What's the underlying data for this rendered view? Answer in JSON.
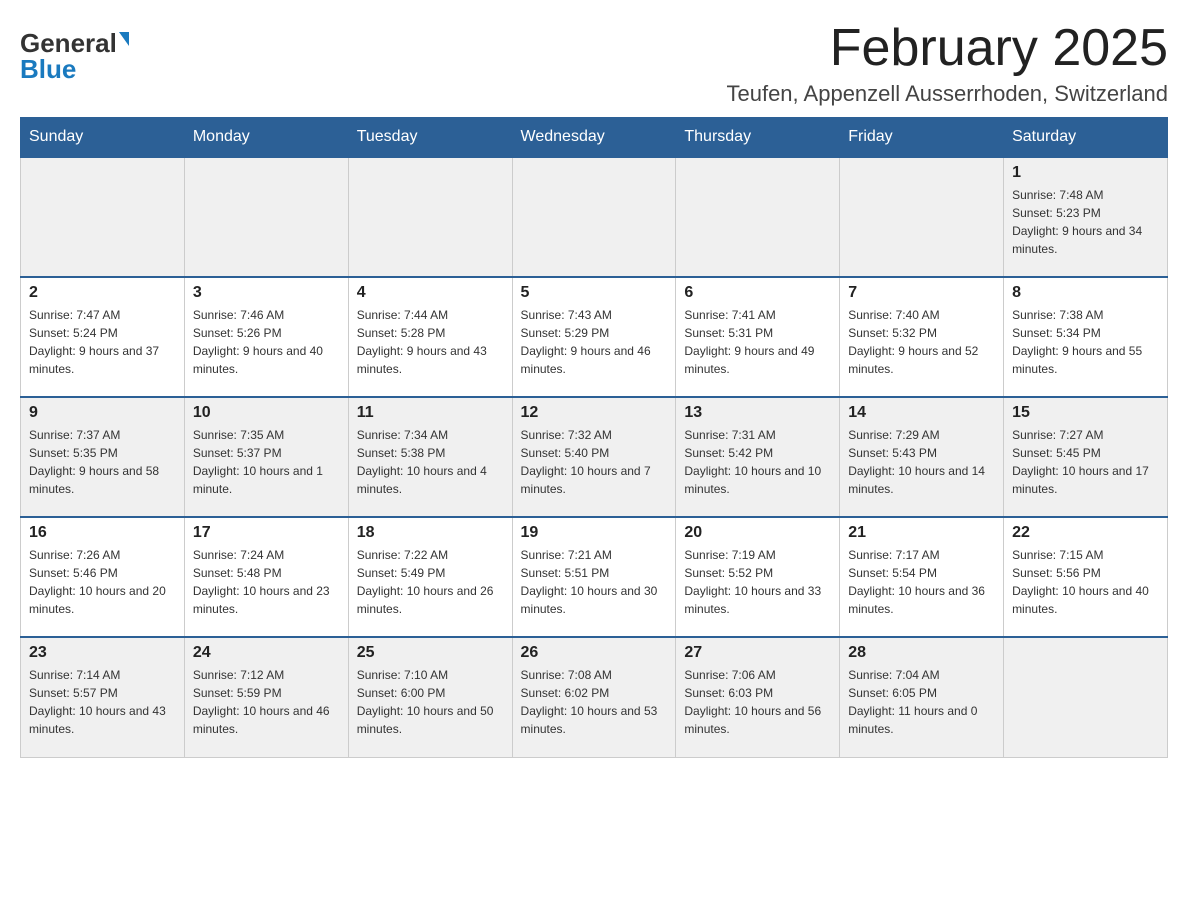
{
  "header": {
    "logo_general": "General",
    "logo_blue": "Blue",
    "month_title": "February 2025",
    "location": "Teufen, Appenzell Ausserrhoden, Switzerland"
  },
  "calendar": {
    "days_of_week": [
      "Sunday",
      "Monday",
      "Tuesday",
      "Wednesday",
      "Thursday",
      "Friday",
      "Saturday"
    ],
    "weeks": [
      {
        "row_class": "row-odd",
        "days": [
          {
            "num": "",
            "info": ""
          },
          {
            "num": "",
            "info": ""
          },
          {
            "num": "",
            "info": ""
          },
          {
            "num": "",
            "info": ""
          },
          {
            "num": "",
            "info": ""
          },
          {
            "num": "",
            "info": ""
          },
          {
            "num": "1",
            "info": "Sunrise: 7:48 AM\nSunset: 5:23 PM\nDaylight: 9 hours and 34 minutes."
          }
        ]
      },
      {
        "row_class": "row-even",
        "days": [
          {
            "num": "2",
            "info": "Sunrise: 7:47 AM\nSunset: 5:24 PM\nDaylight: 9 hours and 37 minutes."
          },
          {
            "num": "3",
            "info": "Sunrise: 7:46 AM\nSunset: 5:26 PM\nDaylight: 9 hours and 40 minutes."
          },
          {
            "num": "4",
            "info": "Sunrise: 7:44 AM\nSunset: 5:28 PM\nDaylight: 9 hours and 43 minutes."
          },
          {
            "num": "5",
            "info": "Sunrise: 7:43 AM\nSunset: 5:29 PM\nDaylight: 9 hours and 46 minutes."
          },
          {
            "num": "6",
            "info": "Sunrise: 7:41 AM\nSunset: 5:31 PM\nDaylight: 9 hours and 49 minutes."
          },
          {
            "num": "7",
            "info": "Sunrise: 7:40 AM\nSunset: 5:32 PM\nDaylight: 9 hours and 52 minutes."
          },
          {
            "num": "8",
            "info": "Sunrise: 7:38 AM\nSunset: 5:34 PM\nDaylight: 9 hours and 55 minutes."
          }
        ]
      },
      {
        "row_class": "row-odd",
        "days": [
          {
            "num": "9",
            "info": "Sunrise: 7:37 AM\nSunset: 5:35 PM\nDaylight: 9 hours and 58 minutes."
          },
          {
            "num": "10",
            "info": "Sunrise: 7:35 AM\nSunset: 5:37 PM\nDaylight: 10 hours and 1 minute."
          },
          {
            "num": "11",
            "info": "Sunrise: 7:34 AM\nSunset: 5:38 PM\nDaylight: 10 hours and 4 minutes."
          },
          {
            "num": "12",
            "info": "Sunrise: 7:32 AM\nSunset: 5:40 PM\nDaylight: 10 hours and 7 minutes."
          },
          {
            "num": "13",
            "info": "Sunrise: 7:31 AM\nSunset: 5:42 PM\nDaylight: 10 hours and 10 minutes."
          },
          {
            "num": "14",
            "info": "Sunrise: 7:29 AM\nSunset: 5:43 PM\nDaylight: 10 hours and 14 minutes."
          },
          {
            "num": "15",
            "info": "Sunrise: 7:27 AM\nSunset: 5:45 PM\nDaylight: 10 hours and 17 minutes."
          }
        ]
      },
      {
        "row_class": "row-even",
        "days": [
          {
            "num": "16",
            "info": "Sunrise: 7:26 AM\nSunset: 5:46 PM\nDaylight: 10 hours and 20 minutes."
          },
          {
            "num": "17",
            "info": "Sunrise: 7:24 AM\nSunset: 5:48 PM\nDaylight: 10 hours and 23 minutes."
          },
          {
            "num": "18",
            "info": "Sunrise: 7:22 AM\nSunset: 5:49 PM\nDaylight: 10 hours and 26 minutes."
          },
          {
            "num": "19",
            "info": "Sunrise: 7:21 AM\nSunset: 5:51 PM\nDaylight: 10 hours and 30 minutes."
          },
          {
            "num": "20",
            "info": "Sunrise: 7:19 AM\nSunset: 5:52 PM\nDaylight: 10 hours and 33 minutes."
          },
          {
            "num": "21",
            "info": "Sunrise: 7:17 AM\nSunset: 5:54 PM\nDaylight: 10 hours and 36 minutes."
          },
          {
            "num": "22",
            "info": "Sunrise: 7:15 AM\nSunset: 5:56 PM\nDaylight: 10 hours and 40 minutes."
          }
        ]
      },
      {
        "row_class": "row-odd",
        "days": [
          {
            "num": "23",
            "info": "Sunrise: 7:14 AM\nSunset: 5:57 PM\nDaylight: 10 hours and 43 minutes."
          },
          {
            "num": "24",
            "info": "Sunrise: 7:12 AM\nSunset: 5:59 PM\nDaylight: 10 hours and 46 minutes."
          },
          {
            "num": "25",
            "info": "Sunrise: 7:10 AM\nSunset: 6:00 PM\nDaylight: 10 hours and 50 minutes."
          },
          {
            "num": "26",
            "info": "Sunrise: 7:08 AM\nSunset: 6:02 PM\nDaylight: 10 hours and 53 minutes."
          },
          {
            "num": "27",
            "info": "Sunrise: 7:06 AM\nSunset: 6:03 PM\nDaylight: 10 hours and 56 minutes."
          },
          {
            "num": "28",
            "info": "Sunrise: 7:04 AM\nSunset: 6:05 PM\nDaylight: 11 hours and 0 minutes."
          },
          {
            "num": "",
            "info": ""
          }
        ]
      }
    ]
  }
}
